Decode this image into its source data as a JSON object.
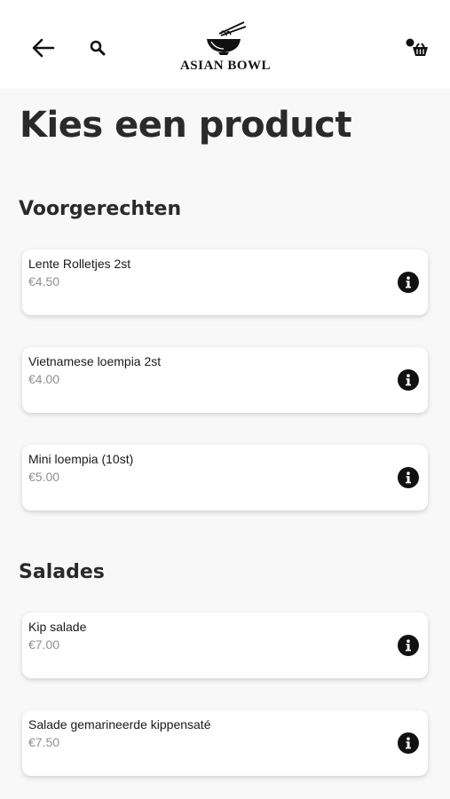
{
  "header": {
    "logo_text": "ASIAN BOWL",
    "icons": [
      "arrow-left-icon",
      "search-icon",
      "logo-bowl-icon",
      "cart-icon"
    ]
  },
  "page_title": "Kies een product",
  "sections": [
    {
      "title": "Voorgerechten",
      "items": [
        {
          "name": "Lente Rolletjes 2st",
          "price": "€4.50"
        },
        {
          "name": "Vietnamese loempia 2st",
          "price": "€4.00"
        },
        {
          "name": "Mini loempia (10st)",
          "price": "€5.00"
        }
      ]
    },
    {
      "title": "Salades",
      "items": [
        {
          "name": "Kip salade",
          "price": "€7.00"
        },
        {
          "name": "Salade gemarineerde kippensaté",
          "price": "€7.50"
        }
      ]
    }
  ],
  "colors": {
    "background": "#f8f8f8",
    "card": "#ffffff",
    "text": "#1a1a1a",
    "price": "#8f8f8f",
    "icon": "#111111"
  }
}
